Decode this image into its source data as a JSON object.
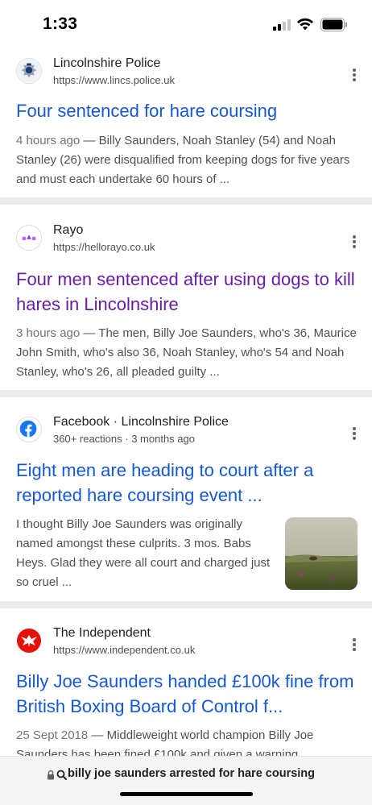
{
  "status_bar": {
    "time": "1:33"
  },
  "results": [
    {
      "site_name": "Lincolnshire Police",
      "site_url": "https://www.lincs.police.uk",
      "favicon": "police-crest-icon",
      "title": "Four sentenced for hare coursing",
      "snippet_date": "4 hours ago",
      "snippet_text": " — Billy Saunders, Noah Stanley (54) and Noah Stanley (26) were disqualified from keeping dogs for five years and must each undertake 60 hours of ..."
    },
    {
      "site_name": "Rayo",
      "site_url": "https://hellorayo.co.uk",
      "favicon": "rayo-icon",
      "title": "Four men sentenced after using dogs to kill hares in Lincolnshire",
      "snippet_date": "3 hours ago",
      "snippet_text": " — The men, Billy Joe Saunders, who's 36, Maurice John Smith, who's also 36, Noah Stanley, who's 54 and Noah Stanley, who's 26, all pleaded guilty ..."
    },
    {
      "site_name": "Facebook · Lincolnshire Police",
      "site_url": "360+ reactions · 3 months ago",
      "favicon": "facebook-icon",
      "title": "Eight men are heading to court after a reported hare coursing event ...",
      "snippet_text": "I thought Billy Joe Saunders was originally named amongst these culprits. 3 mos. Babs Heys. Glad they were all court and charged just so cruel ..."
    },
    {
      "site_name": "The Independent",
      "site_url": "https://www.independent.co.uk",
      "favicon": "independent-eagle-icon",
      "title": "Billy Joe Saunders handed £100k fine from British Boxing Board of Control f...",
      "snippet_date": "25 Sept 2018",
      "snippet_text": " — Middleweight world champion Billy Joe Saunders has been fined £100k and given a warning ..."
    }
  ],
  "address_bar": {
    "query": "billy joe saunders arrested for hare coursing u"
  },
  "colors": {
    "link_blue": "#1558d6",
    "visited_purple": "#681da8",
    "snippet_gray": "#4d5156",
    "divider": "#ececec"
  }
}
